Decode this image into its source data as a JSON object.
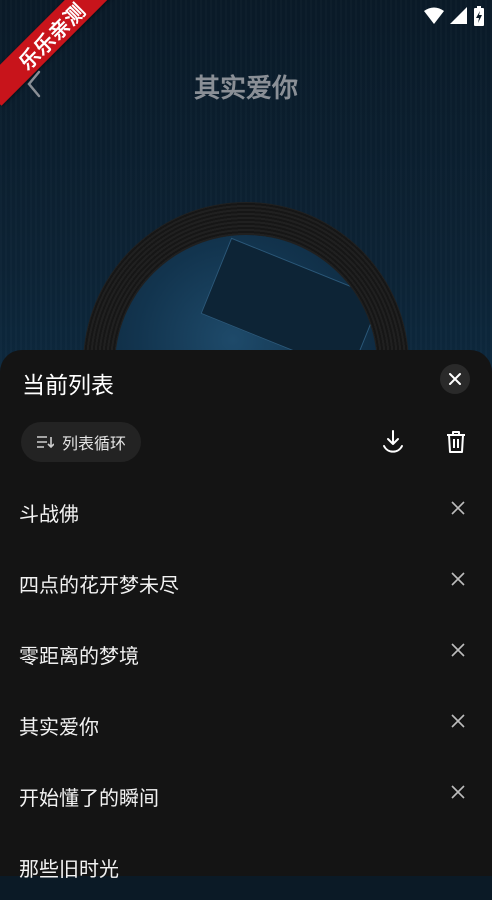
{
  "watermark": "乐乐亲测",
  "header": {
    "title": "其实爱你"
  },
  "sheet": {
    "title": "当前列表",
    "play_mode": "列表循环",
    "songs": [
      "斗战佛",
      "四点的花开梦未尽",
      "零距离的梦境",
      "其实爱你",
      "开始懂了的瞬间",
      "那些旧时光"
    ]
  },
  "colors": {
    "ribbon": "#c8141b",
    "sheet_bg": "#141414",
    "title_gray": "#8a8f96"
  },
  "icons": [
    "wifi-icon",
    "signal-icon",
    "battery-icon",
    "back-icon",
    "close-icon",
    "play-mode-list-icon",
    "download-icon",
    "trash-icon",
    "remove-icon"
  ]
}
